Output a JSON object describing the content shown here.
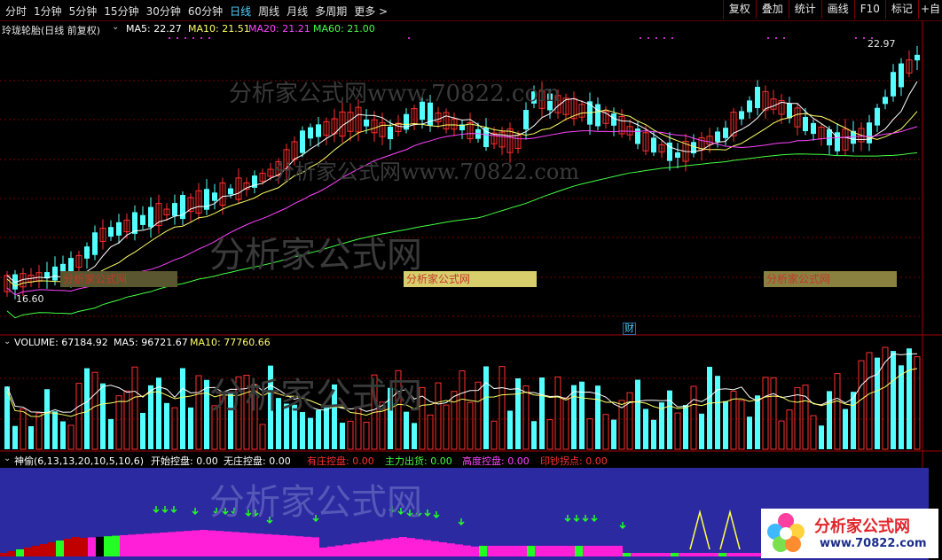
{
  "toolbar": {
    "periods": [
      "分时",
      "1分钟",
      "5分钟",
      "15分钟",
      "30分钟",
      "60分钟",
      "日线",
      "周线",
      "月线",
      "多周期",
      "更多 >"
    ],
    "active_period": "日线",
    "right_buttons": [
      "复权",
      "叠加",
      "统计",
      "画线",
      "F10",
      "标记"
    ],
    "right_edge": "+自"
  },
  "main_chart": {
    "title": "玲珑轮胎(日线 前复权)",
    "ma5_label": "MA5: 22.27",
    "ma10_label": "MA10: 21.51",
    "ma20_label": "MA20: 21.21",
    "ma60_label": "MA60: 21.00",
    "high_marker": "22.97",
    "low_marker": "16.60",
    "fin_marker": "财",
    "colors": {
      "ma5": "#ffffff",
      "ma10": "#ffff66",
      "ma20": "#ff44ff",
      "ma60": "#44ff44",
      "up": "#ff3030",
      "down": "#54ffff"
    }
  },
  "volume_chart": {
    "label": "VOLUME: 67184.92",
    "ma5_label": "MA5: 96721.67",
    "ma10_label": "MA10: 77760.66"
  },
  "indicator": {
    "name": "神偷(6,13,13,20,10,5,10,6)",
    "items": [
      {
        "label": "开始控盘: 0.00",
        "color": "#ffffff"
      },
      {
        "label": "无庄控盘: 0.00",
        "color": "#ffffff"
      },
      {
        "label": "有庄控盘: 0.00",
        "color": "#ff3030"
      },
      {
        "label": "主力出货: 0.00",
        "color": "#44ff44"
      },
      {
        "label": "高度控盘: 0.00",
        "color": "#ff44ff"
      },
      {
        "label": "印钞拐点: 0.00",
        "color": "#ff3030"
      }
    ]
  },
  "watermarks": {
    "text1": "分析家公式网www.70822.com",
    "text2": "分析家公式网",
    "box": "分析家公式网"
  },
  "logo": {
    "name": "分析家公式网",
    "url": "www.70822.com"
  }
}
